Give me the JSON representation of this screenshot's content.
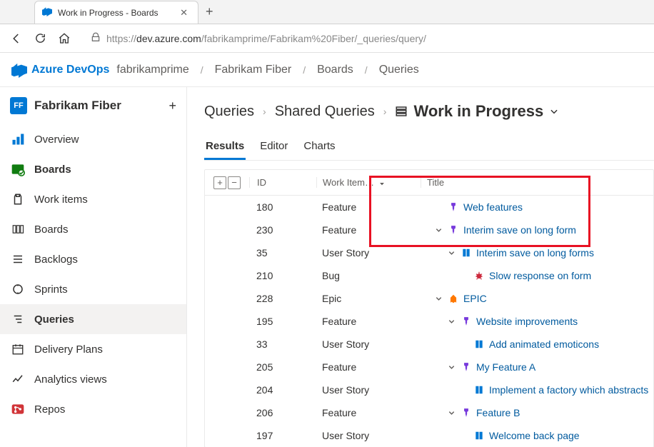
{
  "browser": {
    "tab_title": "Work in Progress - Boards",
    "url_host": "dev.azure.com",
    "url_path": "/fabrikamprime/Fabrikam%20Fiber/_queries/query/"
  },
  "product": "Azure DevOps",
  "top_crumbs": [
    "fabrikamprime",
    "Fabrikam Fiber",
    "Boards",
    "Queries"
  ],
  "project": {
    "initials": "FF",
    "name": "Fabrikam Fiber"
  },
  "sidebar": [
    {
      "label": "Overview",
      "icon": "overview"
    },
    {
      "label": "Boards",
      "icon": "boards",
      "bold": true
    },
    {
      "label": "Work items",
      "icon": "workitems"
    },
    {
      "label": "Boards",
      "icon": "board2"
    },
    {
      "label": "Backlogs",
      "icon": "backlogs"
    },
    {
      "label": "Sprints",
      "icon": "sprints"
    },
    {
      "label": "Queries",
      "icon": "queries",
      "bold": true,
      "active": true
    },
    {
      "label": "Delivery Plans",
      "icon": "plans"
    },
    {
      "label": "Analytics views",
      "icon": "analytics"
    },
    {
      "label": "Repos",
      "icon": "repos"
    }
  ],
  "breadcrumb": {
    "root": "Queries",
    "folder": "Shared Queries",
    "query": "Work in Progress"
  },
  "tabs": [
    "Results",
    "Editor",
    "Charts"
  ],
  "columns": {
    "id": "ID",
    "type": "Work Item…",
    "title": "Title"
  },
  "rows": [
    {
      "id": "180",
      "type": "Feature",
      "title": "Web features",
      "icon": "feature",
      "indent": 1,
      "expander": ""
    },
    {
      "id": "230",
      "type": "Feature",
      "title": "Interim save on long form",
      "icon": "feature",
      "indent": 1,
      "expander": "down"
    },
    {
      "id": "35",
      "type": "User Story",
      "title": "Interim save on long forms",
      "icon": "story",
      "indent": 2,
      "expander": "down"
    },
    {
      "id": "210",
      "type": "Bug",
      "title": "Slow response on form",
      "icon": "bug",
      "indent": 3,
      "expander": ""
    },
    {
      "id": "228",
      "type": "Epic",
      "title": "EPIC",
      "icon": "epic",
      "indent": 1,
      "expander": "down"
    },
    {
      "id": "195",
      "type": "Feature",
      "title": "Website improvements",
      "icon": "feature",
      "indent": 2,
      "expander": "down"
    },
    {
      "id": "33",
      "type": "User Story",
      "title": "Add animated emoticons",
      "icon": "story",
      "indent": 3,
      "expander": ""
    },
    {
      "id": "205",
      "type": "Feature",
      "title": "My Feature A",
      "icon": "feature",
      "indent": 2,
      "expander": "down"
    },
    {
      "id": "204",
      "type": "User Story",
      "title": "Implement a factory which abstracts",
      "icon": "story",
      "indent": 3,
      "expander": ""
    },
    {
      "id": "206",
      "type": "Feature",
      "title": "Feature B",
      "icon": "feature",
      "indent": 2,
      "expander": "down"
    },
    {
      "id": "197",
      "type": "User Story",
      "title": "Welcome back page",
      "icon": "story",
      "indent": 3,
      "expander": ""
    }
  ],
  "icons": {
    "feature_color": "#773adc",
    "story_color": "#0078d4",
    "bug_color": "#cc293d",
    "epic_color": "#ff7800"
  }
}
